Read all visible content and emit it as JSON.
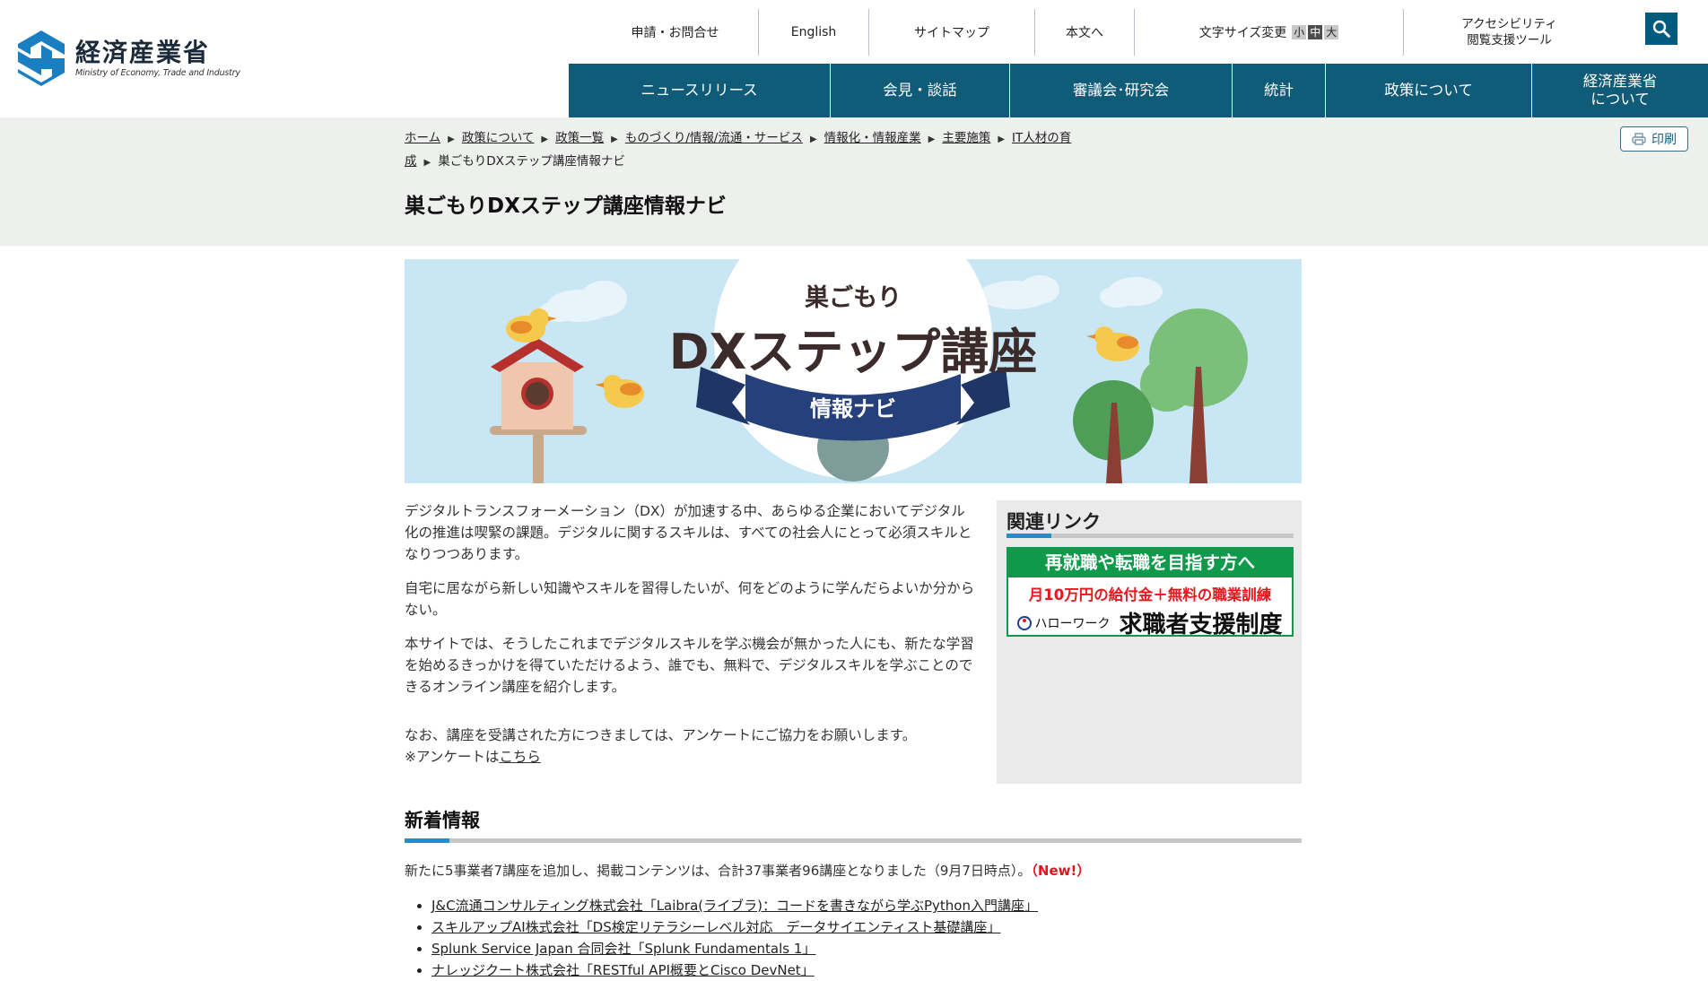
{
  "header": {
    "logo": {
      "name_ja": "経済産業省",
      "name_en": "Ministry of Economy, Trade and Industry"
    },
    "util_nav": {
      "items": [
        "申請・お問合せ",
        "English",
        "サイトマップ",
        "本文へ"
      ],
      "font_size": {
        "label": "文字サイズ変更",
        "small": "小",
        "medium": "中",
        "large": "大",
        "selected": "中"
      },
      "accessibility": {
        "line1": "アクセシビリティ",
        "line2": "閲覧支援ツール"
      }
    },
    "search_icon": "search-icon",
    "global_nav": [
      {
        "line1": "ニュースリリース"
      },
      {
        "line1": "会見・談話"
      },
      {
        "line1": "審議会･研究会"
      },
      {
        "line1": "統計"
      },
      {
        "line1": "政策について"
      },
      {
        "line1": "経済産業省",
        "line2": "について"
      }
    ]
  },
  "breadcrumb": {
    "items": [
      "ホーム",
      "政策について",
      "政策一覧",
      "ものづくり/情報/流通・サービス",
      "情報化・情報産業",
      "主要施策",
      "IT人材の育",
      "成"
    ],
    "current": "巣ごもりDXステップ講座情報ナビ"
  },
  "print_button": "印刷",
  "page_title": "巣ごもりDXステップ講座情報ナビ",
  "banner": {
    "top_text": "巣ごもり",
    "main_text": "DXステップ講座",
    "ribbon_text": "情報ナビ"
  },
  "intro": {
    "paragraphs": [
      "デジタルトランスフォーメーション（DX）が加速する中、あらゆる企業においてデジタル化の推進は喫緊の課題。デジタルに関するスキルは、すべての社会人にとって必須スキルとなりつつあります。",
      "自宅に居ながら新しい知識やスキルを習得したいが、何をどのように学んだらよいか分からない。",
      "本サイトでは、そうしたこれまでデジタルスキルを学ぶ機会が無かった人にも、新たな学習を始めるきっかけを得ていただけるよう、誰でも、無料で、デジタルスキルを学ぶことのできるオンライン講座を紹介します。"
    ],
    "survey_text": "なお、講座を受講された方につきましては、アンケートにご協力をお願いします。",
    "survey_prefix": "※アンケートは",
    "survey_link": "こちら"
  },
  "sidebar": {
    "title": "関連リンク",
    "ad": {
      "top": "再就職や転職を目指す方へ",
      "red": "月10万円の給付金＋無料の職業訓練",
      "hellowork": "ハローワーク",
      "big": "求職者支援制度"
    }
  },
  "news": {
    "title": "新着情報",
    "summary": "新たに5事業者7講座を追加し、掲載コンテンツは、合計37事業者96講座となりました（9月7日時点）。",
    "new_label": "（New!）",
    "items": [
      "J&C流通コンサルティング株式会社「Laibra(ライブラ)：コードを書きながら学ぶPython入門講座」",
      "スキルアップAI株式会社「DS検定リテラシーレベル対応　データサイエンティスト基礎講座」",
      "Splunk Service Japan 合同会社「Splunk Fundamentals 1」",
      "ナレッジクート株式会社「RESTful API概要とCisco DevNet」"
    ]
  },
  "colors": {
    "nav_bg": "#0f5b78",
    "accent": "#1e90c8",
    "green": "#0e9a4a",
    "red": "#e1161e",
    "band_bg": "#eef0ee"
  }
}
